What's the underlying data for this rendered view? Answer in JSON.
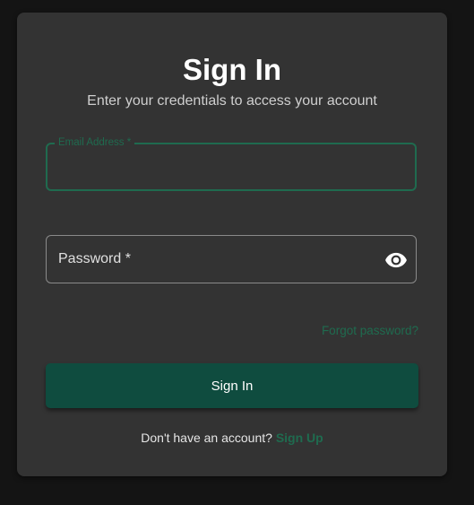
{
  "form": {
    "title": "Sign In",
    "subtitle": "Enter your credentials to access your account",
    "email": {
      "label": "Email Address *",
      "value": ""
    },
    "password": {
      "label": "Password *",
      "value": ""
    },
    "forgot_link": "Forgot password?",
    "submit_label": "Sign In",
    "footer_text": "Don't have an account?",
    "signup_link": "Sign Up"
  },
  "colors": {
    "page_background": "#141414",
    "card_background": "#333333",
    "accent": "#1f6b4f",
    "button": "#0f4c3f"
  }
}
